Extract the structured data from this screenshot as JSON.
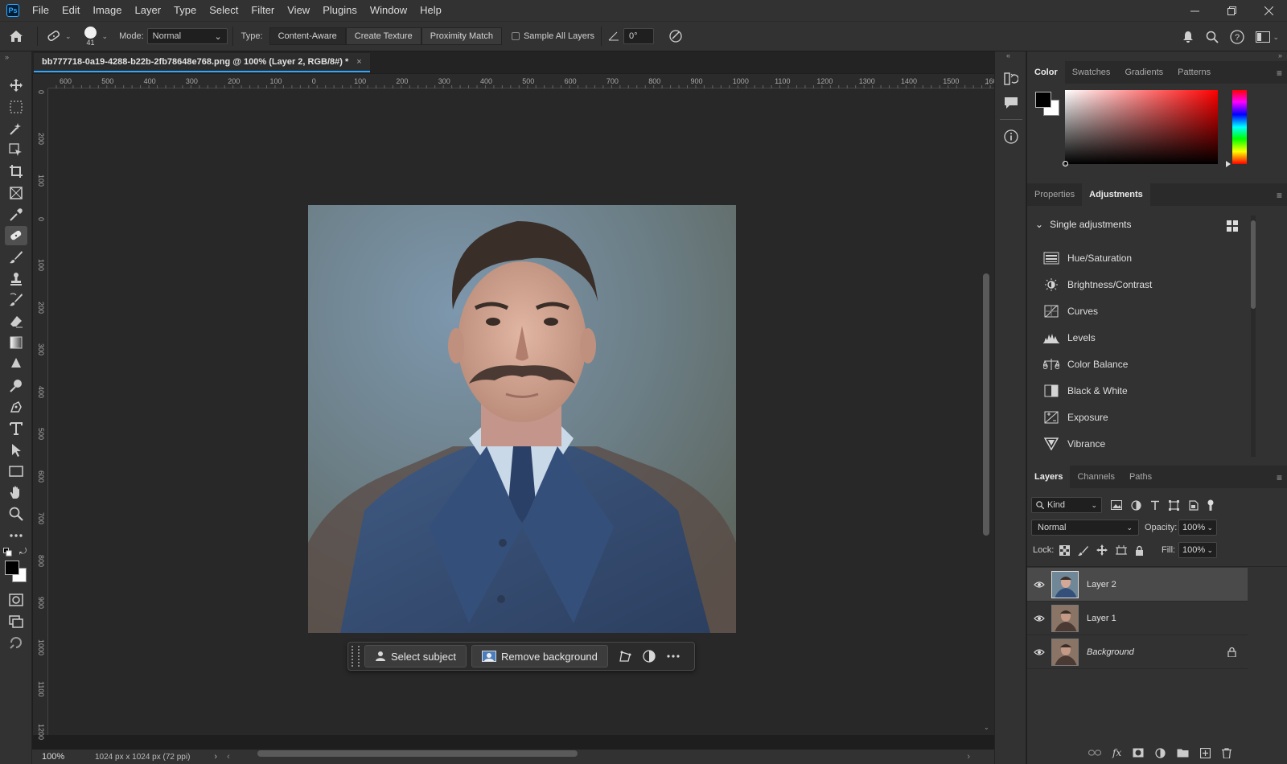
{
  "menu": {
    "logo": "Ps",
    "items": [
      "File",
      "Edit",
      "Image",
      "Layer",
      "Type",
      "Select",
      "Filter",
      "View",
      "Plugins",
      "Window",
      "Help"
    ]
  },
  "options": {
    "brush_size": "41",
    "mode_label": "Mode:",
    "mode_value": "Normal",
    "type_label": "Type:",
    "type_buttons": [
      "Content-Aware",
      "Create Texture",
      "Proximity Match"
    ],
    "sample_label": "Sample All Layers",
    "angle_value": "0°"
  },
  "document": {
    "tab_title": "bb777718-0a19-4288-b22b-2fb78648e768.png @ 100% (Layer 2, RGB/8#) *",
    "ruler_h": [
      "600",
      "500",
      "400",
      "300",
      "200",
      "100",
      "0",
      "100",
      "200",
      "300",
      "400",
      "500",
      "600",
      "700",
      "800",
      "900",
      "1000",
      "1100",
      "1200",
      "1300",
      "1400",
      "1500",
      "1600"
    ],
    "ruler_v": [
      "0",
      "2 0 0",
      "1 0 0",
      "0",
      "1 0 0",
      "2 0 0",
      "3 0 0",
      "4 0 0",
      "5 0 0",
      "6 0 0",
      "7 0 0",
      "8 0 0",
      "9 0 0",
      "1 0 0 0",
      "1 1 0 0",
      "1 2 0 0"
    ]
  },
  "contextual_bar": {
    "select_subject": "Select subject",
    "remove_background": "Remove background"
  },
  "status": {
    "zoom": "100%",
    "dimensions": "1024 px x 1024 px (72 ppi)"
  },
  "color_panel": {
    "tabs": [
      "Color",
      "Swatches",
      "Gradients",
      "Patterns"
    ],
    "active_tab": "Color",
    "foreground": "#000000",
    "background": "#ffffff"
  },
  "adjustments_panel": {
    "tabs": [
      "Properties",
      "Adjustments"
    ],
    "active_tab": "Adjustments",
    "section_title": "Single adjustments",
    "items": [
      {
        "label": "Hue/Saturation",
        "icon": "hue-saturation-icon"
      },
      {
        "label": "Brightness/Contrast",
        "icon": "brightness-icon"
      },
      {
        "label": "Curves",
        "icon": "curves-icon"
      },
      {
        "label": "Levels",
        "icon": "levels-icon"
      },
      {
        "label": "Color Balance",
        "icon": "color-balance-icon"
      },
      {
        "label": "Black & White",
        "icon": "black-white-icon"
      },
      {
        "label": "Exposure",
        "icon": "exposure-icon"
      },
      {
        "label": "Vibrance",
        "icon": "vibrance-icon"
      }
    ]
  },
  "layers_panel": {
    "tabs": [
      "Layers",
      "Channels",
      "Paths"
    ],
    "active_tab": "Layers",
    "filter_value": "Kind",
    "blend_mode": "Normal",
    "opacity_label": "Opacity:",
    "opacity_value": "100%",
    "lock_label": "Lock:",
    "fill_label": "Fill:",
    "fill_value": "100%",
    "layers": [
      {
        "name": "Layer 2",
        "selected": true,
        "locked": false
      },
      {
        "name": "Layer 1",
        "selected": false,
        "locked": false
      },
      {
        "name": "Background",
        "selected": false,
        "locked": true
      }
    ]
  }
}
